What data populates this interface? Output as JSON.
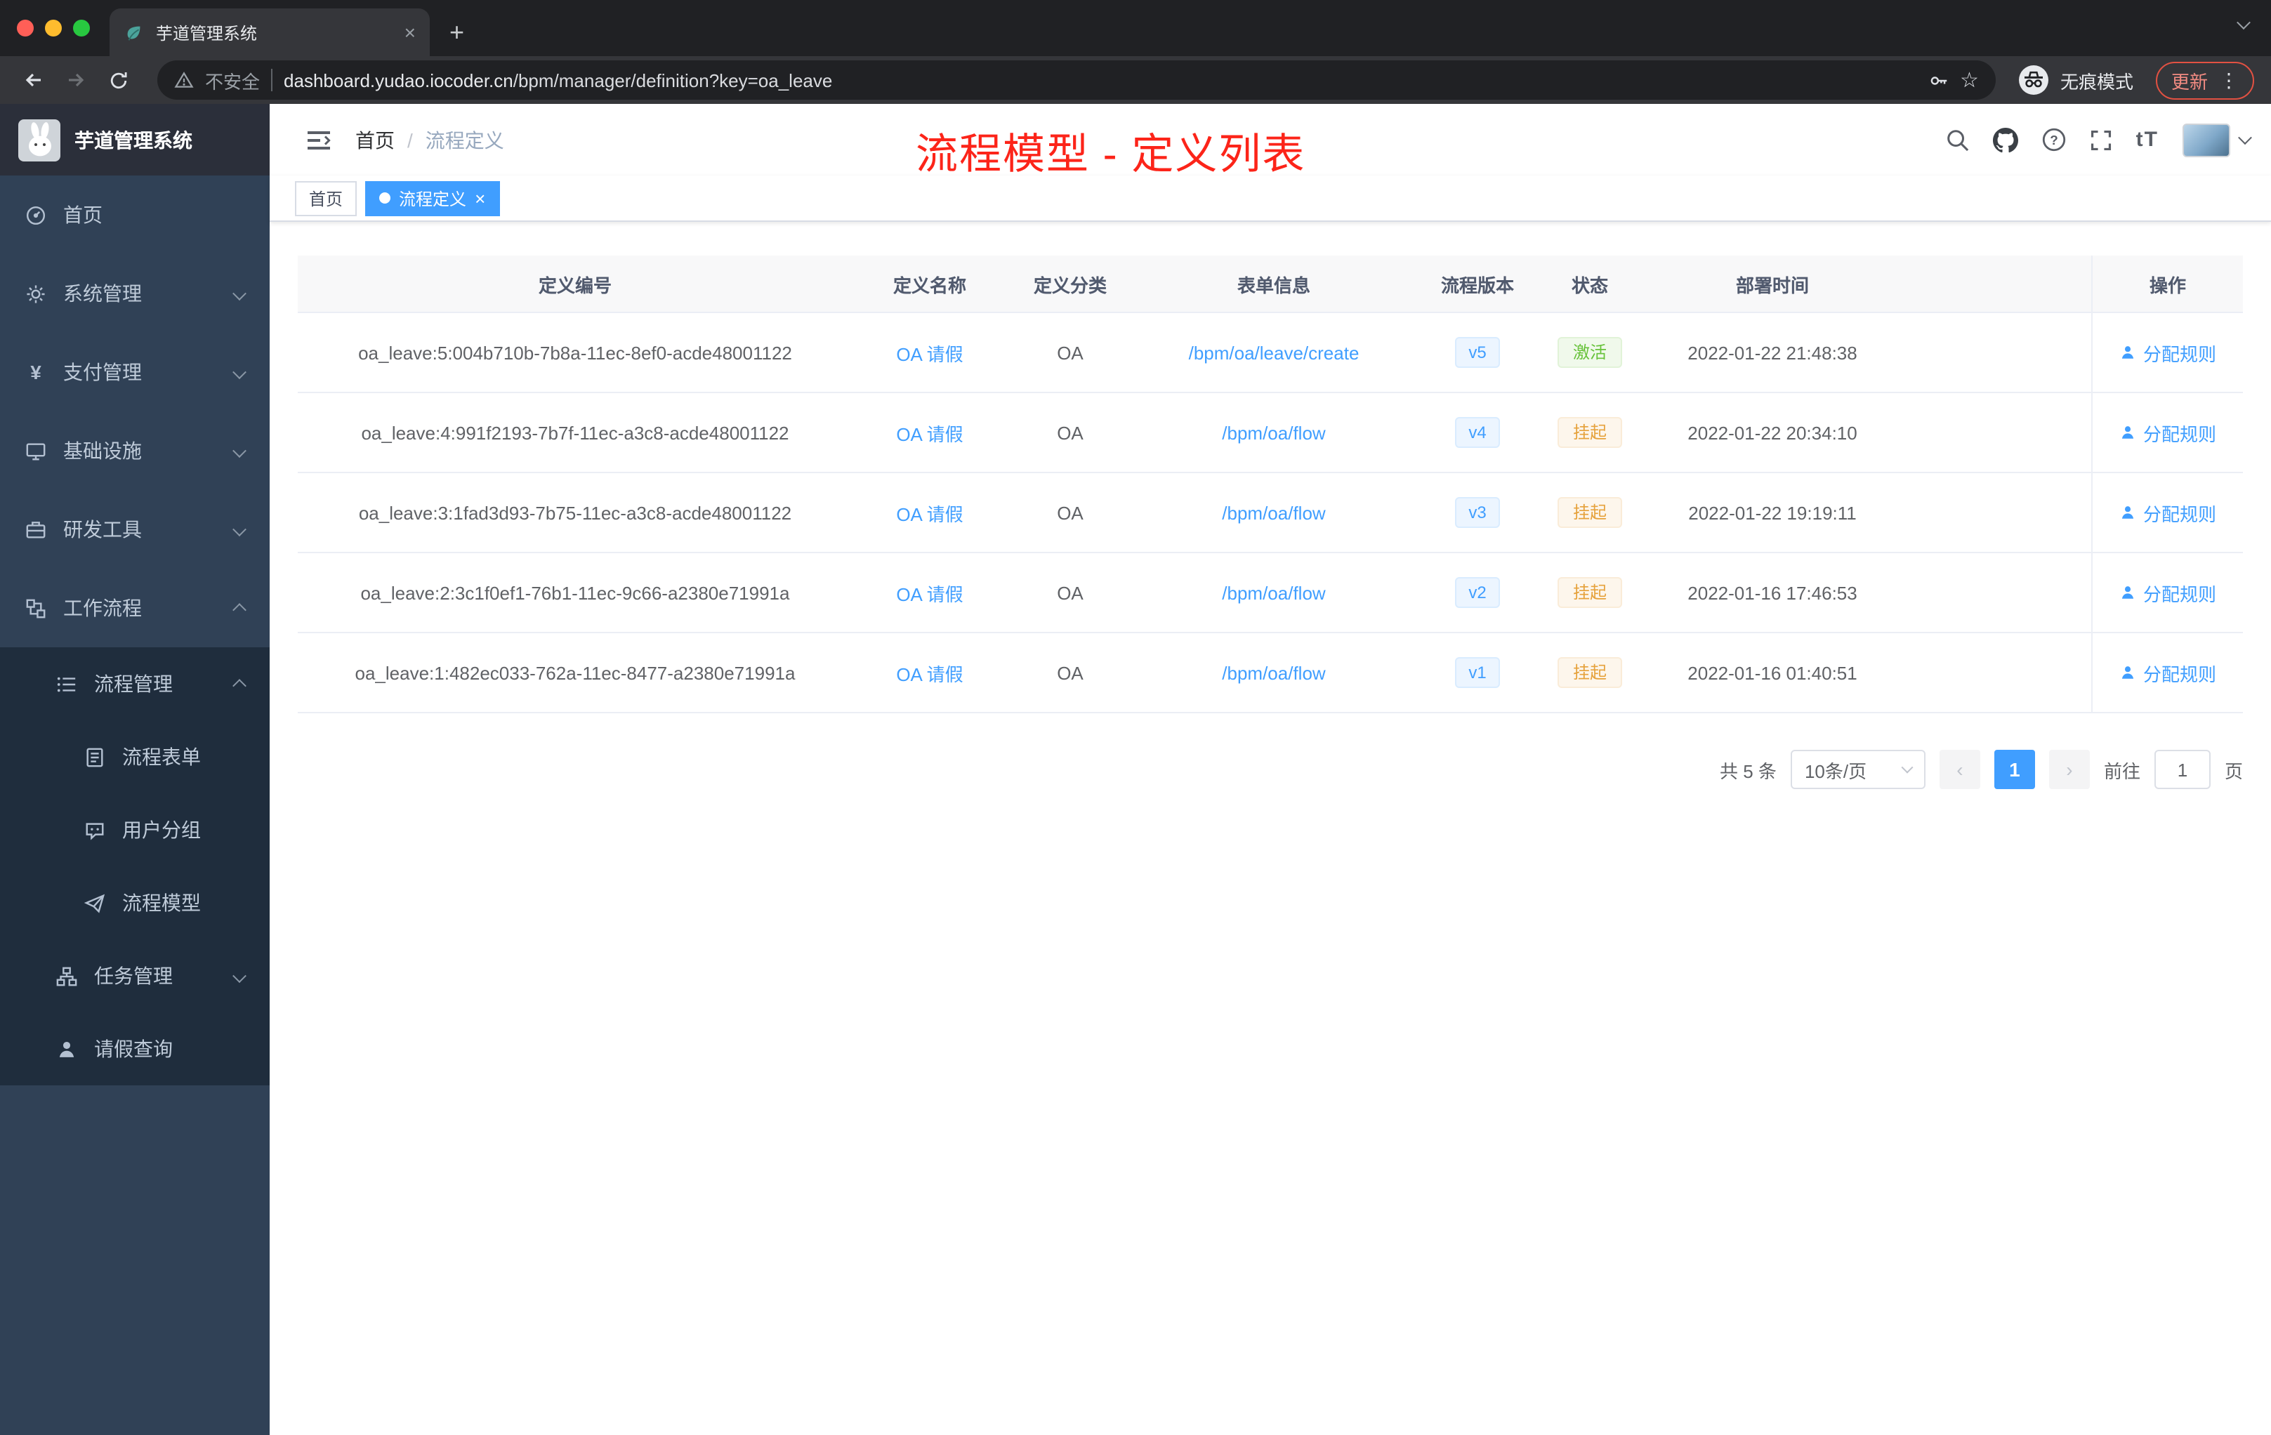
{
  "colors": {
    "accent": "#409eff",
    "annotation": "#fc2419",
    "success": "#67c23a",
    "warning": "#e6a23c",
    "sidebar_bg": "#304156",
    "submenu_bg": "#1f2d3d"
  },
  "glyphs": {
    "close": "×",
    "plus": "+",
    "star": "☆",
    "menu_dots": "⋮",
    "font_size": "tT"
  },
  "browser": {
    "tab_title": "芋道管理系统",
    "security_label": "不安全",
    "url_domain": "dashboard.yudao.iocoder.cn",
    "url_path": "/bpm/manager/definition?key=oa_leave",
    "incognito_label": "无痕模式",
    "update_label": "更新"
  },
  "sidebar": {
    "logo_title": "芋道管理系统",
    "items": [
      {
        "label": "首页",
        "icon": "dashboard-icon"
      },
      {
        "label": "系统管理",
        "icon": "gear-icon",
        "arrow": "down"
      },
      {
        "label": "支付管理",
        "icon": "payment-icon",
        "arrow": "down"
      },
      {
        "label": "基础设施",
        "icon": "infrastructure-icon",
        "arrow": "down"
      },
      {
        "label": "研发工具",
        "icon": "devtools-icon",
        "arrow": "down"
      },
      {
        "label": "工作流程",
        "icon": "workflow-icon",
        "arrow": "up"
      }
    ],
    "submenu": [
      {
        "label": "流程管理",
        "icon": "process-management-icon",
        "arrow": "up",
        "level": 2
      },
      {
        "label": "流程表单",
        "icon": "form-icon",
        "level": 3
      },
      {
        "label": "用户分组",
        "icon": "user-group-icon",
        "level": 3
      },
      {
        "label": "流程模型",
        "icon": "process-model-icon",
        "level": 3
      },
      {
        "label": "任务管理",
        "icon": "task-management-icon",
        "arrow": "down",
        "level": 2
      },
      {
        "label": "请假查询",
        "icon": "leave-query-icon",
        "level": 2
      }
    ]
  },
  "header": {
    "breadcrumb_home": "首页",
    "breadcrumb_sep": "/",
    "breadcrumb_current": "流程定义",
    "annotation": "流程模型 - 定义列表"
  },
  "tags": [
    {
      "label": "首页",
      "active": false
    },
    {
      "label": "流程定义",
      "active": true
    }
  ],
  "table": {
    "columns": [
      "定义编号",
      "定义名称",
      "定义分类",
      "表单信息",
      "流程版本",
      "状态",
      "部署时间",
      "操作"
    ],
    "rows": [
      {
        "id": "oa_leave:5:004b710b-7b8a-11ec-8ef0-acde48001122",
        "name": "OA 请假",
        "category": "OA",
        "form": "/bpm/oa/leave/create",
        "version": "v5",
        "status": "激活",
        "status_type": "success",
        "deploy_time": "2022-01-22 21:48:38",
        "action": "分配规则"
      },
      {
        "id": "oa_leave:4:991f2193-7b7f-11ec-a3c8-acde48001122",
        "name": "OA 请假",
        "category": "OA",
        "form": "/bpm/oa/flow",
        "version": "v4",
        "status": "挂起",
        "status_type": "warning",
        "deploy_time": "2022-01-22 20:34:10",
        "action": "分配规则"
      },
      {
        "id": "oa_leave:3:1fad3d93-7b75-11ec-a3c8-acde48001122",
        "name": "OA 请假",
        "category": "OA",
        "form": "/bpm/oa/flow",
        "version": "v3",
        "status": "挂起",
        "status_type": "warning",
        "deploy_time": "2022-01-22 19:19:11",
        "action": "分配规则"
      },
      {
        "id": "oa_leave:2:3c1f0ef1-76b1-11ec-9c66-a2380e71991a",
        "name": "OA 请假",
        "category": "OA",
        "form": "/bpm/oa/flow",
        "version": "v2",
        "status": "挂起",
        "status_type": "warning",
        "deploy_time": "2022-01-16 17:46:53",
        "action": "分配规则"
      },
      {
        "id": "oa_leave:1:482ec033-762a-11ec-8477-a2380e71991a",
        "name": "OA 请假",
        "category": "OA",
        "form": "/bpm/oa/flow",
        "version": "v1",
        "status": "挂起",
        "status_type": "warning",
        "deploy_time": "2022-01-16 01:40:51",
        "action": "分配规则"
      }
    ]
  },
  "pagination": {
    "total": "共 5 条",
    "size": "10条/页",
    "prev": "‹",
    "next": "›",
    "page": "1",
    "goto_label": "前往",
    "goto_value": "1",
    "unit": "页"
  }
}
